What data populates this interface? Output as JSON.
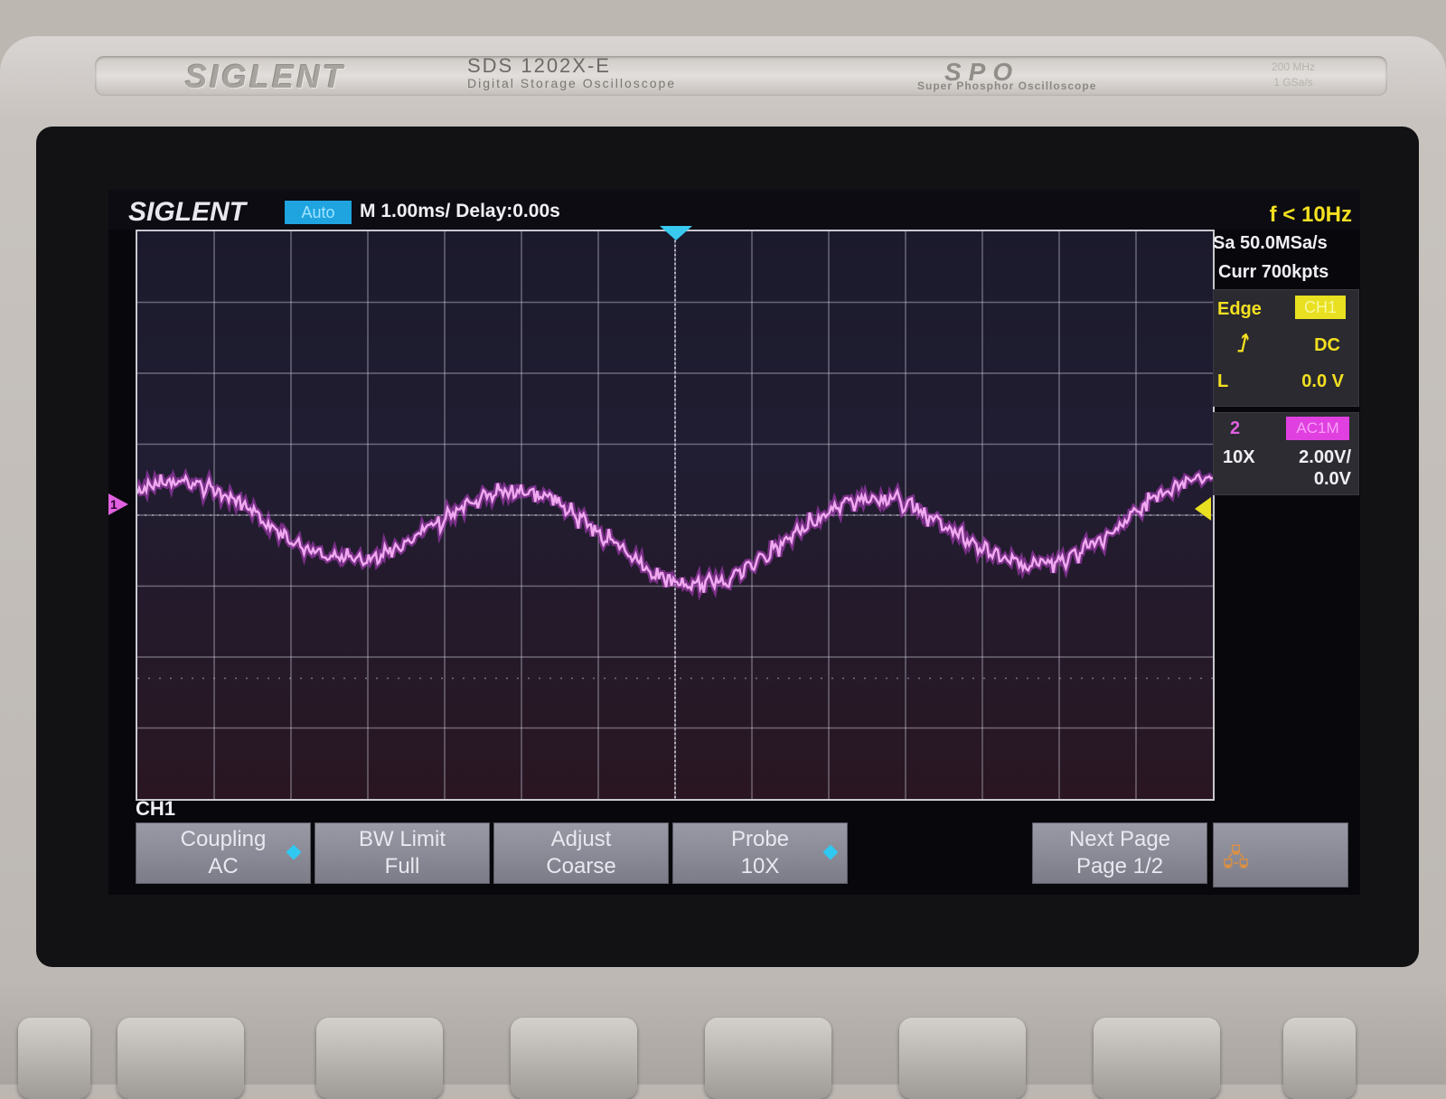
{
  "device": {
    "brand": "SIGLENT",
    "model": "SDS 1202X-E",
    "model_desc": "Digital Storage Oscilloscope",
    "series": "SPO",
    "series_desc": "Super Phosphor Oscilloscope",
    "spec_line1": "200 MHz",
    "spec_line2": "1 GSa/s"
  },
  "header": {
    "logo": "SIGLENT",
    "trigger_mode": "Auto",
    "timebase": "M 1.00ms/ Delay:0.00s"
  },
  "status": {
    "frequency": "f < 10Hz",
    "sample_rate": "Sa 50.0MSa/s",
    "memory": "Curr 700kpts"
  },
  "trigger": {
    "type": "Edge",
    "source": "CH1",
    "coupling": "DC",
    "level_label": "L",
    "level_value": "0.0 V"
  },
  "channel2": {
    "number": "2",
    "coupling": "AC1M",
    "probe": "10X",
    "scale": "2.00V/",
    "offset": "0.0V"
  },
  "channel1_marker": "1",
  "menu": {
    "title": "CH1",
    "keys": [
      {
        "line1": "Coupling",
        "line2": "AC"
      },
      {
        "line1": "BW Limit",
        "line2": "Full"
      },
      {
        "line1": "Adjust",
        "line2": "Coarse"
      },
      {
        "line1": "Probe",
        "line2": "10X"
      },
      {
        "line1": "Next Page",
        "line2": "Page 1/2"
      }
    ]
  },
  "waveform": {
    "color": "#f0a8f0",
    "grid_divisions_x": 14,
    "grid_divisions_y": 8
  },
  "colors": {
    "ch1": "#e060e0",
    "trigger": "#e8e020",
    "accent": "#1fa4e0"
  }
}
